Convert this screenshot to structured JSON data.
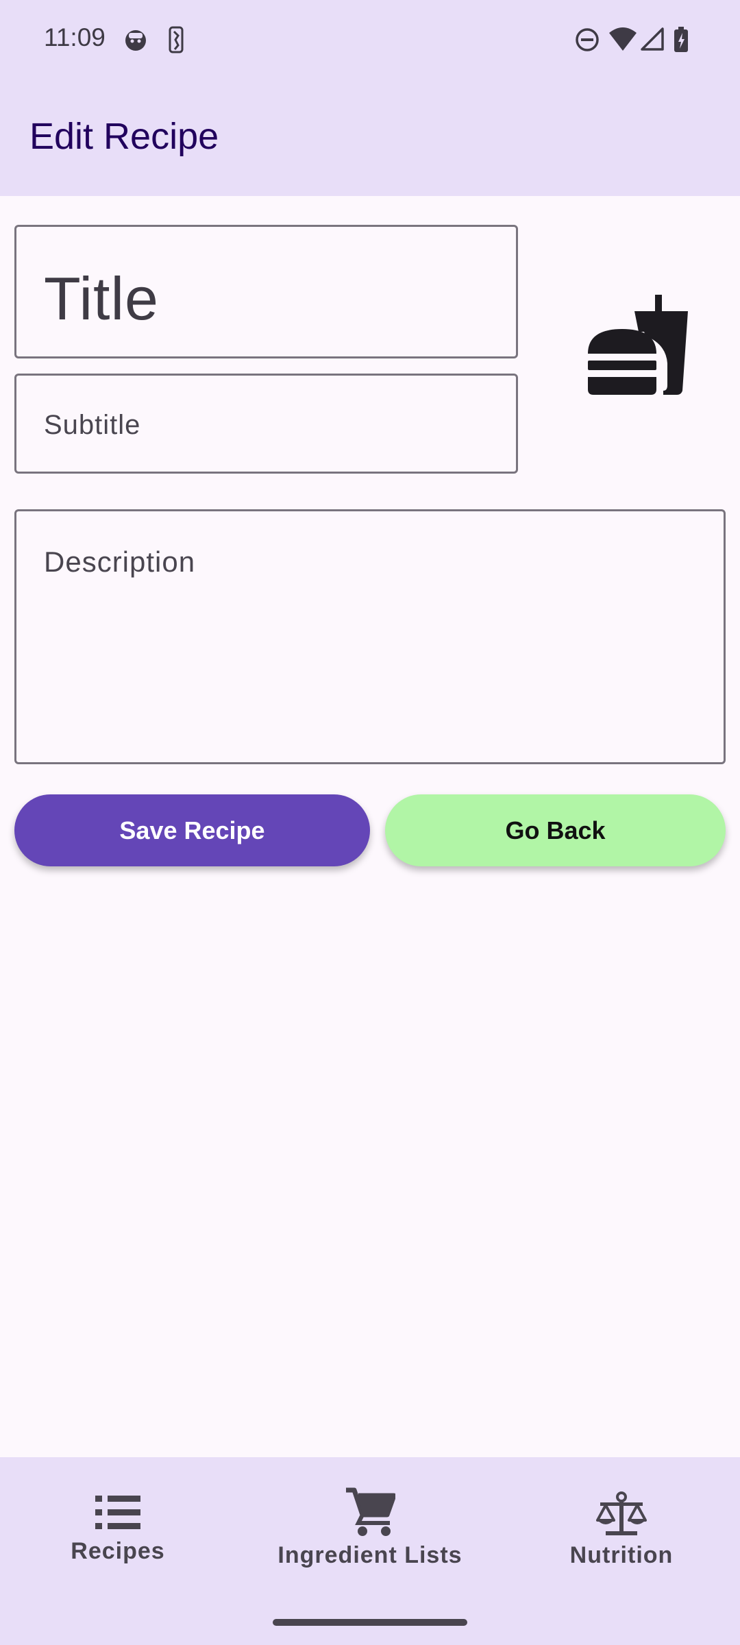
{
  "status_bar": {
    "time": "11:09",
    "left_icons": [
      "face-notification-icon",
      "nba-notification-icon"
    ],
    "right_icons": [
      "do-not-disturb-icon",
      "wifi-icon",
      "signal-icon",
      "battery-charging-icon"
    ]
  },
  "app_bar": {
    "title": "Edit Recipe"
  },
  "form": {
    "title_placeholder": "Title",
    "subtitle_placeholder": "Subtitle",
    "description_placeholder": "Description",
    "category_icon": "fastfood-icon"
  },
  "actions": {
    "save_label": "Save Recipe",
    "back_label": "Go Back"
  },
  "bottom_nav": {
    "items": [
      {
        "label": "Recipes",
        "icon": "list-icon"
      },
      {
        "label": "Ingredient Lists",
        "icon": "cart-icon"
      },
      {
        "label": "Nutrition",
        "icon": "balance-scale-icon"
      }
    ]
  },
  "colors": {
    "bar_background": "#E8DEF8",
    "title_color": "#21005D",
    "save_button": "#6446B7",
    "back_button": "#B1F5A6"
  }
}
